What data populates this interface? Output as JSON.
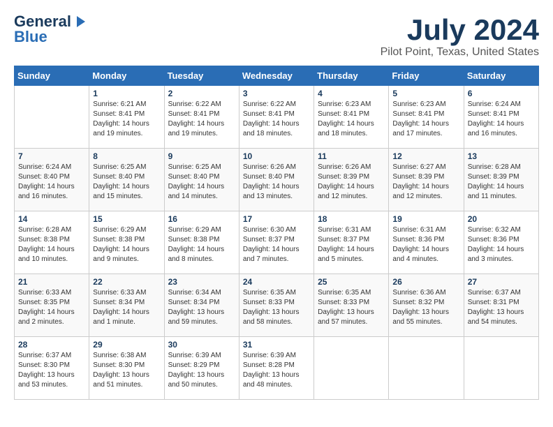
{
  "logo": {
    "line1": "General",
    "line2": "Blue"
  },
  "title": "July 2024",
  "location": "Pilot Point, Texas, United States",
  "days_of_week": [
    "Sunday",
    "Monday",
    "Tuesday",
    "Wednesday",
    "Thursday",
    "Friday",
    "Saturday"
  ],
  "weeks": [
    [
      {
        "day": "",
        "sunrise": "",
        "sunset": "",
        "daylight": ""
      },
      {
        "day": "1",
        "sunrise": "Sunrise: 6:21 AM",
        "sunset": "Sunset: 8:41 PM",
        "daylight": "Daylight: 14 hours and 19 minutes."
      },
      {
        "day": "2",
        "sunrise": "Sunrise: 6:22 AM",
        "sunset": "Sunset: 8:41 PM",
        "daylight": "Daylight: 14 hours and 19 minutes."
      },
      {
        "day": "3",
        "sunrise": "Sunrise: 6:22 AM",
        "sunset": "Sunset: 8:41 PM",
        "daylight": "Daylight: 14 hours and 18 minutes."
      },
      {
        "day": "4",
        "sunrise": "Sunrise: 6:23 AM",
        "sunset": "Sunset: 8:41 PM",
        "daylight": "Daylight: 14 hours and 18 minutes."
      },
      {
        "day": "5",
        "sunrise": "Sunrise: 6:23 AM",
        "sunset": "Sunset: 8:41 PM",
        "daylight": "Daylight: 14 hours and 17 minutes."
      },
      {
        "day": "6",
        "sunrise": "Sunrise: 6:24 AM",
        "sunset": "Sunset: 8:41 PM",
        "daylight": "Daylight: 14 hours and 16 minutes."
      }
    ],
    [
      {
        "day": "7",
        "sunrise": "Sunrise: 6:24 AM",
        "sunset": "Sunset: 8:40 PM",
        "daylight": "Daylight: 14 hours and 16 minutes."
      },
      {
        "day": "8",
        "sunrise": "Sunrise: 6:25 AM",
        "sunset": "Sunset: 8:40 PM",
        "daylight": "Daylight: 14 hours and 15 minutes."
      },
      {
        "day": "9",
        "sunrise": "Sunrise: 6:25 AM",
        "sunset": "Sunset: 8:40 PM",
        "daylight": "Daylight: 14 hours and 14 minutes."
      },
      {
        "day": "10",
        "sunrise": "Sunrise: 6:26 AM",
        "sunset": "Sunset: 8:40 PM",
        "daylight": "Daylight: 14 hours and 13 minutes."
      },
      {
        "day": "11",
        "sunrise": "Sunrise: 6:26 AM",
        "sunset": "Sunset: 8:39 PM",
        "daylight": "Daylight: 14 hours and 12 minutes."
      },
      {
        "day": "12",
        "sunrise": "Sunrise: 6:27 AM",
        "sunset": "Sunset: 8:39 PM",
        "daylight": "Daylight: 14 hours and 12 minutes."
      },
      {
        "day": "13",
        "sunrise": "Sunrise: 6:28 AM",
        "sunset": "Sunset: 8:39 PM",
        "daylight": "Daylight: 14 hours and 11 minutes."
      }
    ],
    [
      {
        "day": "14",
        "sunrise": "Sunrise: 6:28 AM",
        "sunset": "Sunset: 8:38 PM",
        "daylight": "Daylight: 14 hours and 10 minutes."
      },
      {
        "day": "15",
        "sunrise": "Sunrise: 6:29 AM",
        "sunset": "Sunset: 8:38 PM",
        "daylight": "Daylight: 14 hours and 9 minutes."
      },
      {
        "day": "16",
        "sunrise": "Sunrise: 6:29 AM",
        "sunset": "Sunset: 8:38 PM",
        "daylight": "Daylight: 14 hours and 8 minutes."
      },
      {
        "day": "17",
        "sunrise": "Sunrise: 6:30 AM",
        "sunset": "Sunset: 8:37 PM",
        "daylight": "Daylight: 14 hours and 7 minutes."
      },
      {
        "day": "18",
        "sunrise": "Sunrise: 6:31 AM",
        "sunset": "Sunset: 8:37 PM",
        "daylight": "Daylight: 14 hours and 5 minutes."
      },
      {
        "day": "19",
        "sunrise": "Sunrise: 6:31 AM",
        "sunset": "Sunset: 8:36 PM",
        "daylight": "Daylight: 14 hours and 4 minutes."
      },
      {
        "day": "20",
        "sunrise": "Sunrise: 6:32 AM",
        "sunset": "Sunset: 8:36 PM",
        "daylight": "Daylight: 14 hours and 3 minutes."
      }
    ],
    [
      {
        "day": "21",
        "sunrise": "Sunrise: 6:33 AM",
        "sunset": "Sunset: 8:35 PM",
        "daylight": "Daylight: 14 hours and 2 minutes."
      },
      {
        "day": "22",
        "sunrise": "Sunrise: 6:33 AM",
        "sunset": "Sunset: 8:34 PM",
        "daylight": "Daylight: 14 hours and 1 minute."
      },
      {
        "day": "23",
        "sunrise": "Sunrise: 6:34 AM",
        "sunset": "Sunset: 8:34 PM",
        "daylight": "Daylight: 13 hours and 59 minutes."
      },
      {
        "day": "24",
        "sunrise": "Sunrise: 6:35 AM",
        "sunset": "Sunset: 8:33 PM",
        "daylight": "Daylight: 13 hours and 58 minutes."
      },
      {
        "day": "25",
        "sunrise": "Sunrise: 6:35 AM",
        "sunset": "Sunset: 8:33 PM",
        "daylight": "Daylight: 13 hours and 57 minutes."
      },
      {
        "day": "26",
        "sunrise": "Sunrise: 6:36 AM",
        "sunset": "Sunset: 8:32 PM",
        "daylight": "Daylight: 13 hours and 55 minutes."
      },
      {
        "day": "27",
        "sunrise": "Sunrise: 6:37 AM",
        "sunset": "Sunset: 8:31 PM",
        "daylight": "Daylight: 13 hours and 54 minutes."
      }
    ],
    [
      {
        "day": "28",
        "sunrise": "Sunrise: 6:37 AM",
        "sunset": "Sunset: 8:30 PM",
        "daylight": "Daylight: 13 hours and 53 minutes."
      },
      {
        "day": "29",
        "sunrise": "Sunrise: 6:38 AM",
        "sunset": "Sunset: 8:30 PM",
        "daylight": "Daylight: 13 hours and 51 minutes."
      },
      {
        "day": "30",
        "sunrise": "Sunrise: 6:39 AM",
        "sunset": "Sunset: 8:29 PM",
        "daylight": "Daylight: 13 hours and 50 minutes."
      },
      {
        "day": "31",
        "sunrise": "Sunrise: 6:39 AM",
        "sunset": "Sunset: 8:28 PM",
        "daylight": "Daylight: 13 hours and 48 minutes."
      },
      {
        "day": "",
        "sunrise": "",
        "sunset": "",
        "daylight": ""
      },
      {
        "day": "",
        "sunrise": "",
        "sunset": "",
        "daylight": ""
      },
      {
        "day": "",
        "sunrise": "",
        "sunset": "",
        "daylight": ""
      }
    ]
  ]
}
